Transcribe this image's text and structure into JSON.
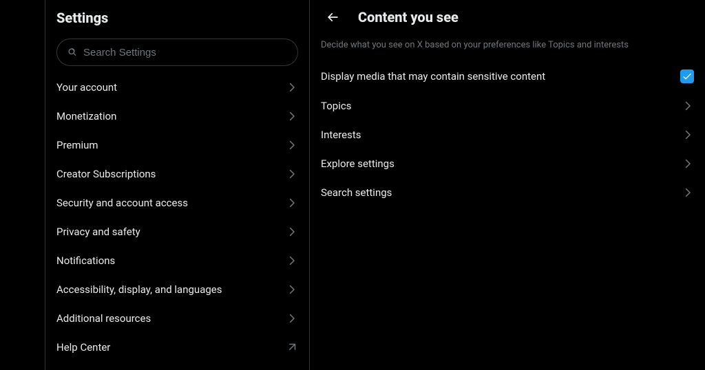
{
  "settings": {
    "title": "Settings",
    "search_placeholder": "Search Settings",
    "nav": [
      {
        "label": "Your account",
        "kind": "internal"
      },
      {
        "label": "Monetization",
        "kind": "internal"
      },
      {
        "label": "Premium",
        "kind": "internal"
      },
      {
        "label": "Creator Subscriptions",
        "kind": "internal"
      },
      {
        "label": "Security and account access",
        "kind": "internal"
      },
      {
        "label": "Privacy and safety",
        "kind": "internal"
      },
      {
        "label": "Notifications",
        "kind": "internal"
      },
      {
        "label": "Accessibility, display, and languages",
        "kind": "internal"
      },
      {
        "label": "Additional resources",
        "kind": "internal"
      },
      {
        "label": "Help Center",
        "kind": "external"
      }
    ]
  },
  "content": {
    "title": "Content you see",
    "description": "Decide what you see on X based on your preferences like Topics and interests",
    "toggle": {
      "label": "Display media that may contain sensitive content",
      "checked": true
    },
    "items": [
      {
        "label": "Topics"
      },
      {
        "label": "Interests"
      },
      {
        "label": "Explore settings"
      },
      {
        "label": "Search settings"
      }
    ]
  },
  "colors": {
    "accent": "#1d9bf0",
    "text": "#e7e9ea",
    "muted": "#71767b",
    "border": "#2f3336",
    "background": "#000000"
  }
}
